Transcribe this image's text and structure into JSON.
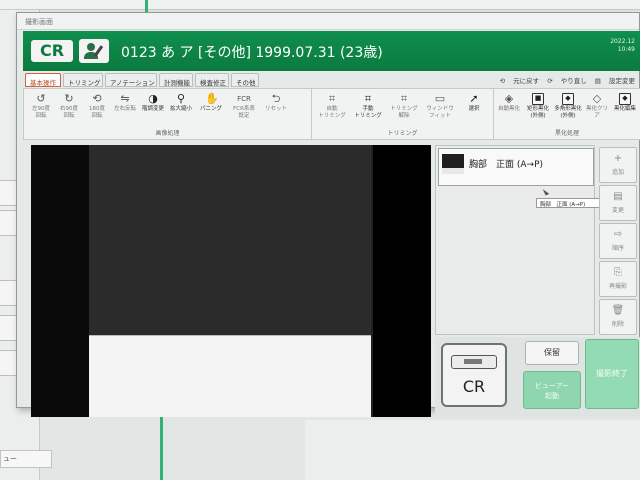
{
  "window": {
    "title": "撮影画面"
  },
  "header": {
    "logo": "CR",
    "patient_info": "0123 あ ア [その他] 1999.07.31 (23歳)",
    "date": "2022.12",
    "time": "10:49"
  },
  "tabs": [
    {
      "label": "基本操作",
      "active": true
    },
    {
      "label": "トリミング",
      "active": false
    },
    {
      "label": "アノテーション",
      "active": false
    },
    {
      "label": "計測機能",
      "active": false
    },
    {
      "label": "検査修正",
      "active": false
    },
    {
      "label": "その他",
      "active": false
    }
  ],
  "top_actions": {
    "undo": "元に戻す",
    "redo": "やり直し",
    "settings": "設定変更"
  },
  "toolbar": {
    "image_processing": {
      "label": "画像処理",
      "buttons": [
        {
          "label1": "左90度",
          "label2": "回転",
          "icon": "rotate-left-icon",
          "glyph": "↺"
        },
        {
          "label1": "右90度",
          "label2": "回転",
          "icon": "rotate-right-icon",
          "glyph": "↻"
        },
        {
          "label1": "180度",
          "label2": "回転",
          "icon": "rotate-180-icon",
          "glyph": "⟲"
        },
        {
          "label1": "左右反転",
          "label2": "",
          "icon": "flip-icon",
          "glyph": "⇋"
        },
        {
          "label1": "階調変更",
          "label2": "",
          "icon": "contrast-icon",
          "glyph": "◑",
          "enabled": true
        },
        {
          "label1": "拡大縮小",
          "label2": "",
          "icon": "zoom-icon",
          "glyph": "⚲",
          "enabled": true
        },
        {
          "label1": "パニング",
          "label2": "",
          "icon": "hand-icon",
          "glyph": "✋",
          "enabled": true
        },
        {
          "label1": "FCR系表",
          "label2": "既定",
          "icon": "fcr-icon",
          "glyph": "FCR"
        },
        {
          "label1": "リセット",
          "label2": "",
          "icon": "reset-icon",
          "glyph": "⮌"
        }
      ]
    },
    "trimming": {
      "label": "トリミング",
      "buttons": [
        {
          "label1": "自動",
          "label2": "トリミング",
          "icon": "auto-trim-icon",
          "glyph": "⌗"
        },
        {
          "label1": "手動",
          "label2": "トリミング",
          "icon": "manual-trim-icon",
          "glyph": "⌗",
          "enabled": true
        },
        {
          "label1": "トリミング",
          "label2": "解除",
          "icon": "trim-release-icon",
          "glyph": "⌗"
        },
        {
          "label1": "ウィンドウ",
          "label2": "フィット",
          "icon": "window-fit-icon",
          "glyph": "▭"
        },
        {
          "label1": "選択",
          "label2": "",
          "icon": "select-icon",
          "glyph": "➚",
          "enabled": true
        }
      ]
    },
    "blackening": {
      "label": "黒化処理",
      "buttons": [
        {
          "label1": "自動黒化",
          "label2": "",
          "icon": "auto-black-icon",
          "glyph": "◈"
        },
        {
          "label1": "矩形黒化",
          "label2": "(外側)",
          "icon": "rect-black-icon",
          "glyph": "■",
          "enabled": true
        },
        {
          "label1": "多角形黒化",
          "label2": "(外側)",
          "icon": "poly-black-icon",
          "glyph": "◆",
          "enabled": true
        },
        {
          "label1": "黒化クリア",
          "label2": "",
          "icon": "black-clear-icon",
          "glyph": "◇"
        },
        {
          "label1": "黒化編集",
          "label2": "",
          "icon": "black-edit-icon",
          "glyph": "◆",
          "enabled": true
        }
      ]
    }
  },
  "exposure_list": {
    "items": [
      {
        "label": "胸部　正面 (A→P)"
      }
    ],
    "tooltip": "胸部　正面 (A→P)"
  },
  "side_buttons": [
    {
      "label": "追加",
      "icon": "add-icon",
      "glyph": "+"
    },
    {
      "label": "変更",
      "icon": "change-icon",
      "glyph": "▤"
    },
    {
      "label": "順序",
      "icon": "order-icon",
      "glyph": "⇨"
    },
    {
      "label": "再撮影",
      "icon": "retake-icon",
      "glyph": "⎘"
    },
    {
      "label": "削除",
      "icon": "delete-icon",
      "glyph": "🗑"
    }
  ],
  "controls": {
    "cassette_label": "CR",
    "hold": "保留",
    "viewer_line1": "ビューアー",
    "viewer_line2": "起動",
    "finish": "撮影終了"
  },
  "background": {
    "bottom_box": "ュー"
  }
}
